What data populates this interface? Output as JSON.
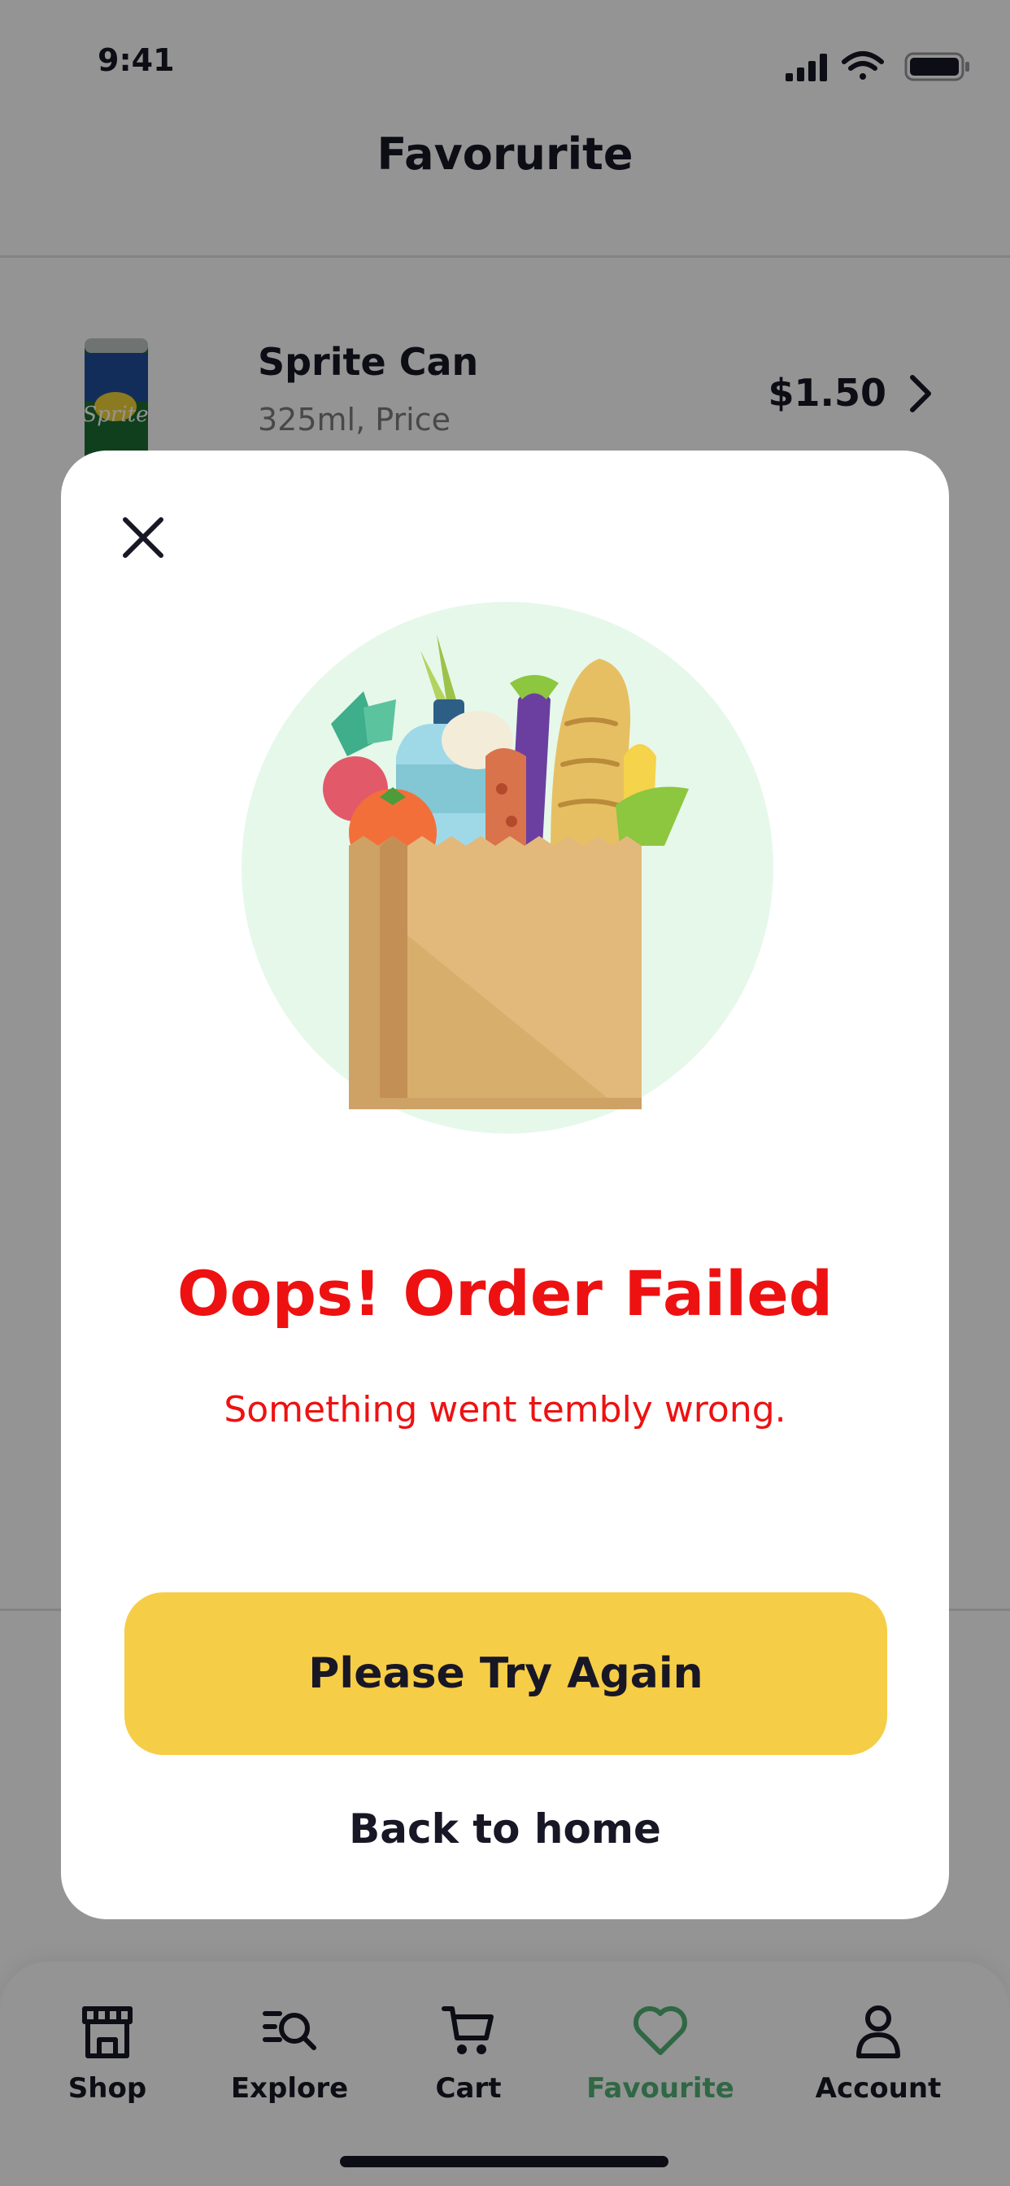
{
  "status_bar": {
    "time": "9:41"
  },
  "header": {
    "title": "Favorurite"
  },
  "favourites": [
    {
      "name": "Sprite Can",
      "subtitle": "325ml, Price",
      "price": "$1.50",
      "image_icon": "sprite-can-icon"
    }
  ],
  "bottom_nav": {
    "items": [
      {
        "label": "Shop",
        "icon": "store-icon",
        "active": false
      },
      {
        "label": "Explore",
        "icon": "explore-search-icon",
        "active": false
      },
      {
        "label": "Cart",
        "icon": "cart-icon",
        "active": false
      },
      {
        "label": "Favourite",
        "icon": "heart-icon",
        "active": true
      },
      {
        "label": "Account",
        "icon": "user-icon",
        "active": false
      }
    ]
  },
  "modal": {
    "close_icon": "close-icon",
    "illustration_icon": "grocery-bag-icon",
    "title": "Oops! Order Failed",
    "subtitle": "Something went tembly wrong.",
    "primary_button": "Please Try Again",
    "secondary_link": "Back to home"
  },
  "colors": {
    "accent_green": "#53B175",
    "error_red": "#EE1111",
    "button_yellow": "#F6CD46",
    "text_dark": "#181725",
    "text_grey": "#7C7C7C"
  }
}
